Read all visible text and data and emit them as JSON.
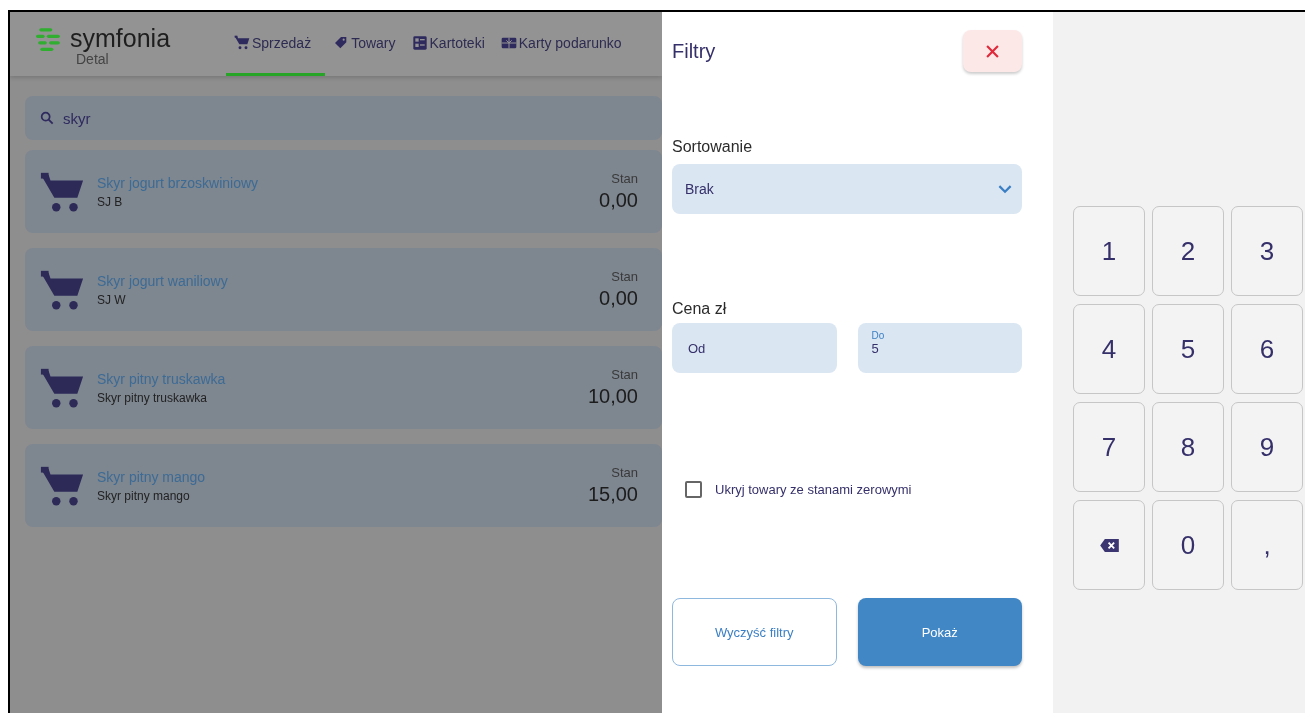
{
  "app": {
    "logo": {
      "name": "symfonia",
      "subtitle": "Detal"
    },
    "tabs": [
      {
        "label": "Sprzedaż",
        "kind": "cart",
        "selected": true
      },
      {
        "label": "Towary",
        "kind": "tag",
        "selected": false
      },
      {
        "label": "Kartoteki",
        "kind": "cards",
        "selected": false
      },
      {
        "label": "Karty podarunko",
        "kind": "gift",
        "selected": false
      }
    ],
    "search": {
      "value": "skyr"
    },
    "products": [
      {
        "name": "Skyr jogurt brzoskwiniowy",
        "code": "SJ B",
        "stock_label": "Stan",
        "stock": "0,00"
      },
      {
        "name": "Skyr jogurt waniliowy",
        "code": "SJ W",
        "stock_label": "Stan",
        "stock": "0,00"
      },
      {
        "name": "Skyr pitny truskawka",
        "code": "Skyr pitny truskawka",
        "stock_label": "Stan",
        "stock": "10,00"
      },
      {
        "name": "Skyr pitny mango",
        "code": "Skyr pitny mango",
        "stock_label": "Stan",
        "stock": "15,00"
      }
    ]
  },
  "filters": {
    "title": "Filtry",
    "sort": {
      "label": "Sortowanie",
      "value": "Brak"
    },
    "price": {
      "label": "Cena zł",
      "from": {
        "placeholder": "Od"
      },
      "to": {
        "label": "Do",
        "value": "5"
      }
    },
    "hide_zero": {
      "label": "Ukryj towary ze stanami zerowymi",
      "checked": false
    },
    "clear_button": "Wyczyść filtry",
    "show_button": "Pokaż"
  },
  "keypad": [
    {
      "label": "1",
      "kind": "digit"
    },
    {
      "label": "2",
      "kind": "digit"
    },
    {
      "label": "3",
      "kind": "digit"
    },
    {
      "label": "4",
      "kind": "digit"
    },
    {
      "label": "5",
      "kind": "digit"
    },
    {
      "label": "6",
      "kind": "digit"
    },
    {
      "label": "7",
      "kind": "digit"
    },
    {
      "label": "8",
      "kind": "digit"
    },
    {
      "label": "9",
      "kind": "digit"
    },
    {
      "kind": "backspace"
    },
    {
      "label": "0",
      "kind": "digit"
    },
    {
      "label": ",",
      "kind": "digit"
    }
  ]
}
